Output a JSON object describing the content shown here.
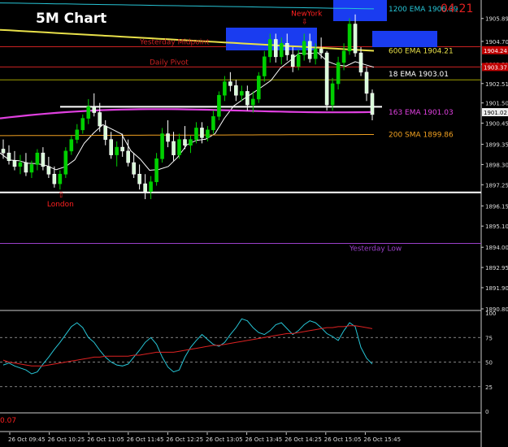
{
  "chart_data": [
    {
      "type": "candlestick",
      "title": "5M Chart",
      "timer": "04:21",
      "ylim": [
        1890.8,
        1906.85
      ],
      "y_ticks": [
        "1905.89",
        "1904.70",
        "1903.51",
        "1902.51",
        "1901.50",
        "1900.45",
        "1899.35",
        "1898.30",
        "1897.25",
        "1896.15",
        "1895.10",
        "1894.00",
        "1892.95",
        "1891.90",
        "1890.80"
      ],
      "x_ticks": [
        "26 Oct 09:45",
        "26 Oct 10:25",
        "26 Oct 11:05",
        "26 Oct 11:45",
        "26 Oct 12:25",
        "26 Oct 13:05",
        "26 Oct 13:45",
        "26 Oct 14:25",
        "26 Oct 15:05",
        "26 Oct 15:45"
      ],
      "price_badges": [
        {
          "text": "1904.24",
          "value": 1904.24,
          "color": "#c00000"
        },
        {
          "text": "1903.37",
          "value": 1903.37,
          "color": "#c00000"
        },
        {
          "text": "1901.02",
          "value": 1901.02,
          "color": "#eeeeee"
        }
      ],
      "candles": [
        [
          1899.1,
          1899.6,
          1898.6,
          1898.9
        ],
        [
          1898.9,
          1899.3,
          1898.3,
          1898.5
        ],
        [
          1898.5,
          1899.0,
          1898.0,
          1898.2
        ],
        [
          1898.2,
          1898.8,
          1897.8,
          1898.4
        ],
        [
          1898.4,
          1898.9,
          1897.7,
          1897.9
        ],
        [
          1897.9,
          1898.5,
          1897.6,
          1898.3
        ],
        [
          1898.3,
          1899.1,
          1898.0,
          1898.9
        ],
        [
          1898.9,
          1899.2,
          1898.0,
          1898.2
        ],
        [
          1898.2,
          1898.7,
          1897.6,
          1897.8
        ],
        [
          1897.8,
          1898.2,
          1897.1,
          1897.3
        ],
        [
          1897.3,
          1898.0,
          1897.0,
          1897.8
        ],
        [
          1897.8,
          1899.2,
          1897.6,
          1899.0
        ],
        [
          1899.0,
          1899.8,
          1898.8,
          1899.6
        ],
        [
          1899.6,
          1900.4,
          1899.4,
          1900.1
        ],
        [
          1900.1,
          1900.9,
          1899.9,
          1900.7
        ],
        [
          1900.7,
          1901.7,
          1900.4,
          1901.3
        ],
        [
          1901.3,
          1902.0,
          1900.8,
          1901.0
        ],
        [
          1901.0,
          1901.5,
          1900.0,
          1900.3
        ],
        [
          1900.3,
          1900.6,
          1899.3,
          1899.6
        ],
        [
          1899.6,
          1900.0,
          1898.6,
          1898.8
        ],
        [
          1898.8,
          1899.5,
          1898.2,
          1899.2
        ],
        [
          1899.2,
          1899.9,
          1898.7,
          1899.0
        ],
        [
          1899.0,
          1899.6,
          1898.2,
          1898.4
        ],
        [
          1898.4,
          1898.9,
          1897.6,
          1897.8
        ],
        [
          1897.8,
          1898.3,
          1897.0,
          1897.3
        ],
        [
          1897.3,
          1897.8,
          1896.5,
          1896.9
        ],
        [
          1896.9,
          1897.7,
          1896.5,
          1897.4
        ],
        [
          1897.4,
          1898.9,
          1897.2,
          1898.6
        ],
        [
          1898.6,
          1900.2,
          1898.4,
          1899.9
        ],
        [
          1899.9,
          1900.6,
          1899.2,
          1899.5
        ],
        [
          1899.5,
          1900.0,
          1898.5,
          1898.8
        ],
        [
          1898.8,
          1899.9,
          1898.6,
          1899.6
        ],
        [
          1899.6,
          1900.3,
          1899.1,
          1899.3
        ],
        [
          1899.3,
          1899.8,
          1898.9,
          1899.6
        ],
        [
          1899.6,
          1900.5,
          1899.4,
          1900.2
        ],
        [
          1900.2,
          1900.5,
          1899.4,
          1899.7
        ],
        [
          1899.7,
          1900.3,
          1899.5,
          1900.1
        ],
        [
          1900.1,
          1901.1,
          1899.9,
          1900.8
        ],
        [
          1900.8,
          1902.1,
          1900.6,
          1901.9
        ],
        [
          1901.9,
          1902.9,
          1901.6,
          1902.6
        ],
        [
          1902.6,
          1903.1,
          1902.1,
          1902.4
        ],
        [
          1902.4,
          1902.7,
          1901.6,
          1901.9
        ],
        [
          1901.9,
          1902.4,
          1901.6,
          1902.1
        ],
        [
          1902.1,
          1902.4,
          1901.1,
          1901.4
        ],
        [
          1901.4,
          1902.1,
          1901.0,
          1901.7
        ],
        [
          1901.7,
          1903.1,
          1901.5,
          1902.9
        ],
        [
          1902.9,
          1904.2,
          1902.6,
          1903.9
        ],
        [
          1903.9,
          1905.1,
          1903.6,
          1904.8
        ],
        [
          1904.8,
          1905.1,
          1903.6,
          1903.9
        ],
        [
          1903.9,
          1904.9,
          1903.5,
          1904.6
        ],
        [
          1904.6,
          1905.1,
          1903.7,
          1904.0
        ],
        [
          1904.0,
          1904.4,
          1903.1,
          1903.4
        ],
        [
          1903.4,
          1904.3,
          1903.2,
          1904.0
        ],
        [
          1904.0,
          1905.1,
          1903.7,
          1904.7
        ],
        [
          1904.7,
          1905.1,
          1903.6,
          1903.8
        ],
        [
          1903.8,
          1904.6,
          1903.5,
          1904.3
        ],
        [
          1904.3,
          1904.9,
          1903.8,
          1904.1
        ],
        [
          1904.1,
          1904.2,
          1901.1,
          1901.4
        ],
        [
          1901.4,
          1902.8,
          1901.1,
          1902.5
        ],
        [
          1902.5,
          1903.9,
          1902.2,
          1903.6
        ],
        [
          1903.6,
          1904.6,
          1903.2,
          1904.2
        ],
        [
          1904.2,
          1905.9,
          1904.0,
          1905.6
        ],
        [
          1905.6,
          1906.1,
          1903.9,
          1904.1
        ],
        [
          1904.1,
          1904.4,
          1902.9,
          1903.1
        ],
        [
          1903.1,
          1903.4,
          1901.6,
          1902.0
        ],
        [
          1902.0,
          1902.2,
          1900.6,
          1900.9
        ]
      ],
      "indicators": [
        {
          "label": "1200 EMA 1906.39",
          "color": "#27c5d6",
          "start": 1906.7,
          "end": 1906.39
        },
        {
          "label": "600 EMA 1904.21",
          "color": "#e8e04a",
          "start": 1905.3,
          "end": 1904.21
        },
        {
          "label": "18 EMA 1903.01",
          "color": "#ffffff",
          "start": 1898.5,
          "end": 1903.01
        },
        {
          "label": "163 EMA 1901.03",
          "color": "#e040e0",
          "start": 1900.7,
          "end": 1901.03
        },
        {
          "label": "200 SMA 1899.86",
          "color": "#f0a020",
          "start": 1899.8,
          "end": 1899.86
        }
      ],
      "levels": [
        {
          "label": "Yesterday Midpoint",
          "value": 1904.42,
          "color": "#cc2222"
        },
        {
          "label": "Daily Pivot",
          "value": 1903.37,
          "color": "#cc2222"
        },
        {
          "label": "",
          "value": 1902.7,
          "color": "#a0a000"
        },
        {
          "label": "",
          "value": 1901.3,
          "color": "#ffffff"
        },
        {
          "label": "",
          "value": 1896.85,
          "color": "#ffffff"
        },
        {
          "label": "Yesterday Low",
          "value": 1894.2,
          "color": "#9a40c8"
        }
      ],
      "session_markers": [
        {
          "label": "London",
          "candle": 10
        },
        {
          "label": "NewYork",
          "candle": 53
        }
      ]
    },
    {
      "type": "line",
      "name": "oscillator",
      "ylim": [
        0,
        100
      ],
      "y_ticks": [
        "100",
        "75",
        "50",
        "25",
        "0"
      ],
      "low_value": "0.07",
      "series": [
        {
          "color": "#27c5d6",
          "values": [
            47,
            49,
            46,
            44,
            42,
            38,
            40,
            48,
            55,
            63,
            70,
            78,
            86,
            90,
            85,
            75,
            70,
            62,
            55,
            50,
            47,
            46,
            48,
            55,
            62,
            70,
            75,
            68,
            55,
            45,
            40,
            42,
            55,
            65,
            72,
            78,
            73,
            68,
            66,
            70,
            78,
            85,
            94,
            92,
            85,
            80,
            78,
            82,
            88,
            90,
            84,
            78,
            82,
            88,
            92,
            90,
            85,
            79,
            76,
            72,
            82,
            90,
            86,
            65,
            54,
            48
          ]
        },
        {
          "color": "#dd2222",
          "values": [
            52,
            50,
            49,
            48,
            47,
            46,
            46,
            46,
            47,
            48,
            49,
            50,
            51,
            52,
            53,
            54,
            55,
            55,
            56,
            56,
            56,
            56,
            56,
            57,
            57,
            58,
            59,
            60,
            60,
            60,
            60,
            61,
            62,
            63,
            64,
            65,
            66,
            67,
            67,
            68,
            69,
            70,
            71,
            72,
            73,
            74,
            75,
            76,
            77,
            78,
            79,
            79,
            80,
            81,
            82,
            83,
            84,
            85,
            85,
            86,
            86,
            87,
            87,
            86,
            85,
            84
          ]
        }
      ]
    }
  ]
}
